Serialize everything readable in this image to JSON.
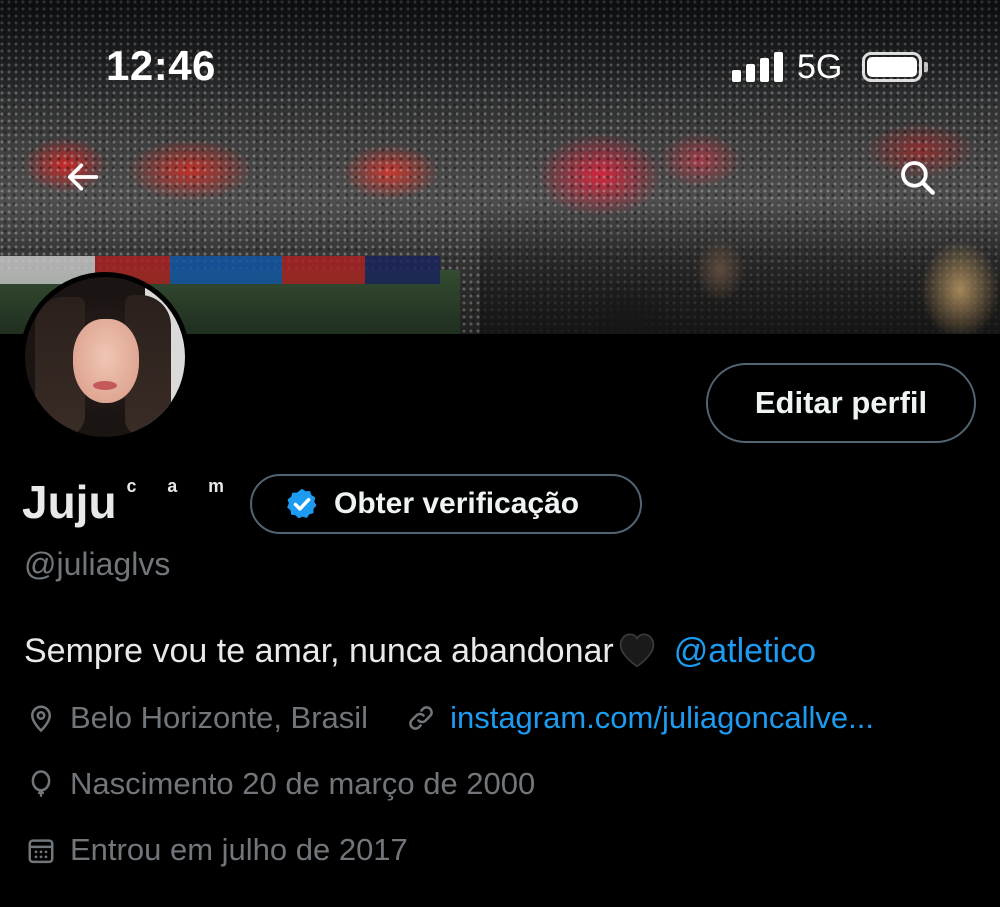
{
  "status_bar": {
    "time": "12:46",
    "network": "5G",
    "signal_bars": 4,
    "battery_level": 0.9
  },
  "banner": {
    "description_icon": "stadium-photo",
    "back_icon": "arrow-left-icon",
    "search_icon": "search-icon"
  },
  "profile": {
    "name": "Juju",
    "name_suffix": "ᶜ ᵃ ᵐ",
    "handle": "@juliaglvs",
    "edit_button": "Editar perfil",
    "verify_button": "Obter verificação",
    "bio_text": "Sempre vou te amar, nunca abandonar",
    "bio_emoji": "black-heart-icon",
    "bio_mention": "@atletico",
    "location": "Belo Horizonte, Brasil",
    "website": "instagram.com/juliagoncallve...",
    "birthday": "Nascimento 20 de março de 2000",
    "joined": "Entrou em julho de 2017"
  },
  "colors": {
    "background": "#000000",
    "text_primary": "#e7e9ea",
    "text_secondary": "#71767b",
    "link": "#1d9bf0",
    "border": "#536471"
  }
}
